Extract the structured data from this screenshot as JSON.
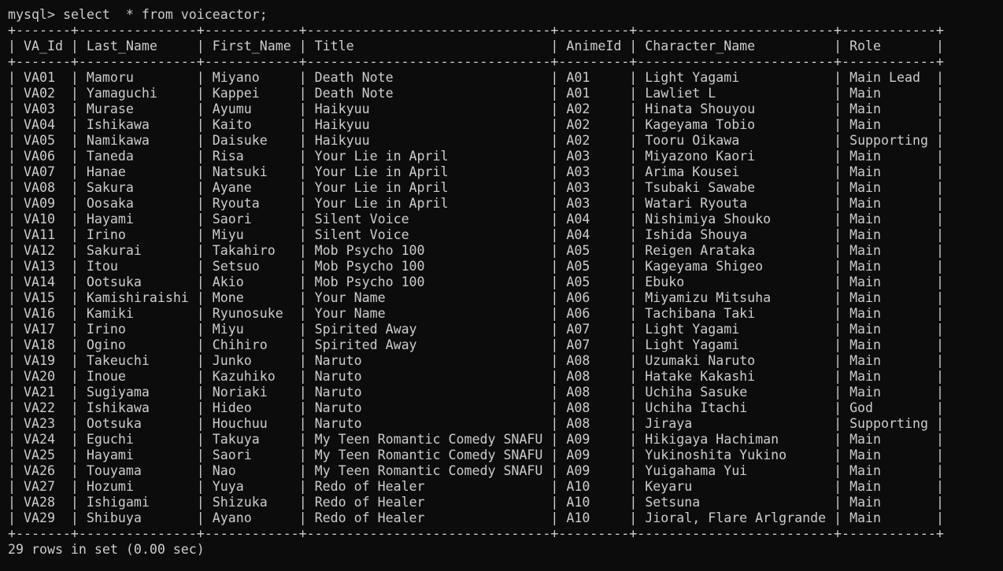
{
  "prompt": "mysql>",
  "command": "select  * from voiceactor;",
  "columns": [
    "VA_Id",
    "Last_Name",
    "First_Name",
    "Title",
    "AnimeId",
    "Character_Name",
    "Role"
  ],
  "rows": [
    [
      "VA01",
      "Mamoru",
      "Miyano",
      "Death Note",
      "A01",
      "Light Yagami",
      "Main Lead"
    ],
    [
      "VA02",
      "Yamaguchi",
      "Kappei",
      "Death Note",
      "A01",
      "Lawliet L",
      "Main"
    ],
    [
      "VA03",
      "Murase",
      "Ayumu",
      "Haikyuu",
      "A02",
      "Hinata Shouyou",
      "Main"
    ],
    [
      "VA04",
      "Ishikawa",
      "Kaito",
      "Haikyuu",
      "A02",
      "Kageyama Tobio",
      "Main"
    ],
    [
      "VA05",
      "Namikawa",
      "Daisuke",
      "Haikyuu",
      "A02",
      "Tooru Oikawa",
      "Supporting"
    ],
    [
      "VA06",
      "Taneda",
      "Risa",
      "Your Lie in April",
      "A03",
      "Miyazono Kaori",
      "Main"
    ],
    [
      "VA07",
      "Hanae",
      "Natsuki",
      "Your Lie in April",
      "A03",
      "Arima Kousei",
      "Main"
    ],
    [
      "VA08",
      "Sakura",
      "Ayane",
      "Your Lie in April",
      "A03",
      "Tsubaki Sawabe",
      "Main"
    ],
    [
      "VA09",
      "Oosaka",
      "Ryouta",
      "Your Lie in April",
      "A03",
      "Watari Ryouta",
      "Main"
    ],
    [
      "VA10",
      "Hayami",
      "Saori",
      "Silent Voice",
      "A04",
      "Nishimiya Shouko",
      "Main"
    ],
    [
      "VA11",
      "Irino",
      "Miyu",
      "Silent Voice",
      "A04",
      "Ishida Shouya",
      "Main"
    ],
    [
      "VA12",
      "Sakurai",
      "Takahiro",
      "Mob Psycho 100",
      "A05",
      "Reigen Arataka",
      "Main"
    ],
    [
      "VA13",
      "Itou",
      "Setsuo",
      "Mob Psycho 100",
      "A05",
      "Kageyama Shigeo",
      "Main"
    ],
    [
      "VA14",
      "Ootsuka",
      "Akio",
      "Mob Psycho 100",
      "A05",
      "Ebuko",
      "Main"
    ],
    [
      "VA15",
      "Kamishiraishi",
      "Mone",
      "Your Name",
      "A06",
      "Miyamizu Mitsuha",
      "Main"
    ],
    [
      "VA16",
      "Kamiki",
      "Ryunosuke",
      "Your Name",
      "A06",
      "Tachibana Taki",
      "Main"
    ],
    [
      "VA17",
      "Irino",
      "Miyu",
      "Spirited Away",
      "A07",
      "Light Yagami",
      "Main"
    ],
    [
      "VA18",
      "Ogino",
      "Chihiro",
      "Spirited Away",
      "A07",
      "Light Yagami",
      "Main"
    ],
    [
      "VA19",
      "Takeuchi",
      "Junko",
      "Naruto",
      "A08",
      "Uzumaki Naruto",
      "Main"
    ],
    [
      "VA20",
      "Inoue",
      "Kazuhiko",
      "Naruto",
      "A08",
      "Hatake Kakashi",
      "Main"
    ],
    [
      "VA21",
      "Sugiyama",
      "Noriaki",
      "Naruto",
      "A08",
      "Uchiha Sasuke",
      "Main"
    ],
    [
      "VA22",
      "Ishikawa",
      "Hideo",
      "Naruto",
      "A08",
      "Uchiha Itachi",
      "God"
    ],
    [
      "VA23",
      "Ootsuka",
      "Houchuu",
      "Naruto",
      "A08",
      "Jiraya",
      "Supporting"
    ],
    [
      "VA24",
      "Eguchi",
      "Takuya",
      "My Teen Romantic Comedy SNAFU",
      "A09",
      "Hikigaya Hachiman",
      "Main"
    ],
    [
      "VA25",
      "Hayami",
      "Saori",
      "My Teen Romantic Comedy SNAFU",
      "A09",
      "Yukinoshita Yukino",
      "Main"
    ],
    [
      "VA26",
      "Touyama",
      "Nao",
      "My Teen Romantic Comedy SNAFU",
      "A09",
      "Yuigahama Yui",
      "Main"
    ],
    [
      "VA27",
      "Hozumi",
      "Yuya",
      "Redo of Healer",
      "A10",
      "Keyaru",
      "Main"
    ],
    [
      "VA28",
      "Ishigami",
      "Shizuka",
      "Redo of Healer",
      "A10",
      "Setsuna",
      "Main"
    ],
    [
      "VA29",
      "Shibuya",
      "Ayano",
      "Redo of Healer",
      "A10",
      "Jioral, Flare Arlgrande",
      "Main"
    ]
  ],
  "footer": "29 rows in set (0.00 sec)",
  "colors": {
    "background": "#0c0c0c",
    "text": "#cccccc"
  }
}
